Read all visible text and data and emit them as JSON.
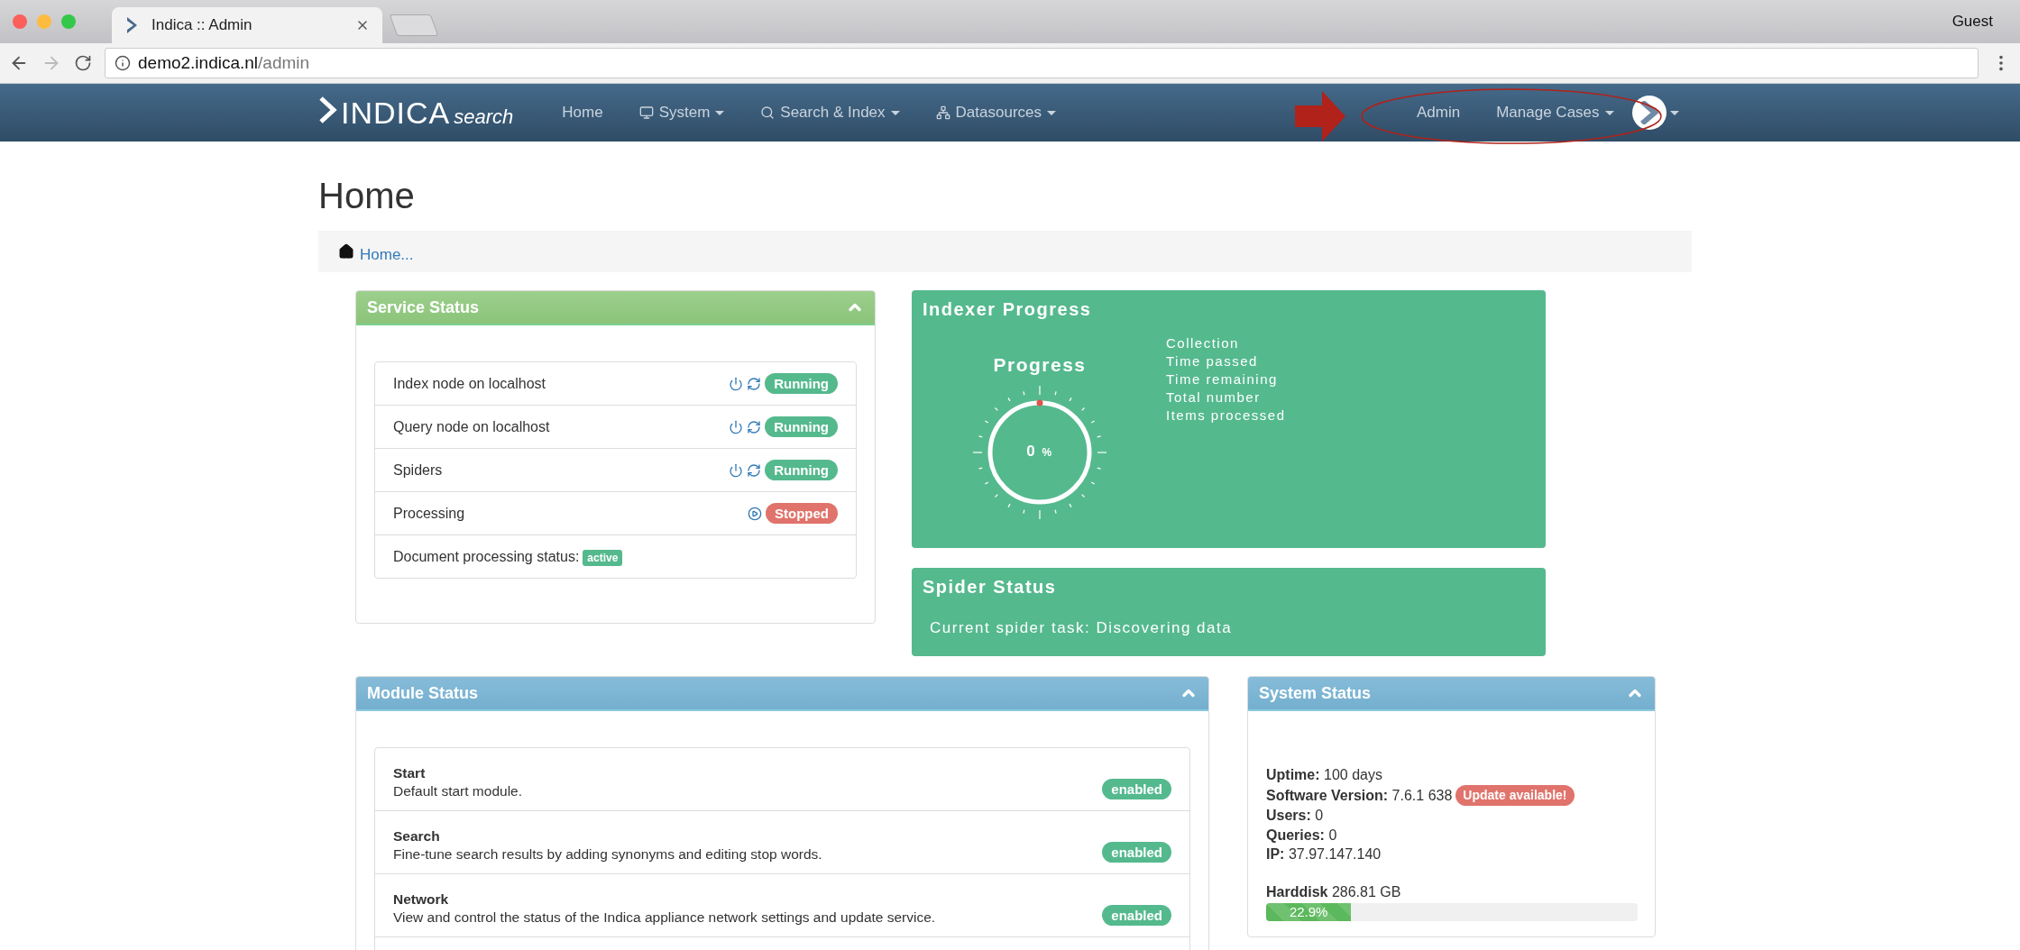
{
  "browser": {
    "tab_title": "Indica :: Admin",
    "address_host": "demo2.indica.nl",
    "address_path": "/admin",
    "profile": "Guest"
  },
  "navbar": {
    "brand": "INDICA",
    "brand_suffix": "search",
    "items": [
      {
        "label": "Home",
        "kind": "link"
      },
      {
        "label": "System",
        "kind": "menu"
      },
      {
        "label": "Search & Index",
        "kind": "menu"
      },
      {
        "label": "Datasources",
        "kind": "menu"
      }
    ],
    "right_items": [
      {
        "label": "Admin",
        "kind": "link"
      },
      {
        "label": "Manage Cases",
        "kind": "menu"
      }
    ]
  },
  "page": {
    "title": "Home",
    "breadcrumb": "Home..."
  },
  "service_status": {
    "title": "Service Status",
    "rows": [
      {
        "name": "Index node on localhost",
        "kind": "service",
        "running": true,
        "status": "Running"
      },
      {
        "name": "Query node on localhost",
        "kind": "service",
        "running": true,
        "status": "Running"
      },
      {
        "name": "Spiders",
        "kind": "service",
        "running": true,
        "status": "Running"
      },
      {
        "name": "Processing",
        "kind": "service",
        "running": false,
        "status": "Stopped"
      },
      {
        "name": "Document processing status:",
        "kind": "note",
        "status": "active"
      }
    ]
  },
  "indexer_progress": {
    "title": "Indexer Progress",
    "gauge_title": "Progress",
    "reading": "0",
    "unit": "%",
    "labels": [
      "Collection",
      "Time passed",
      "Time remaining",
      "Total number",
      "Items processed"
    ]
  },
  "spider_status": {
    "title": "Spider Status",
    "text": "Current spider task: Discovering data"
  },
  "module_status": {
    "title": "Module Status",
    "modules": [
      {
        "name": "Start",
        "description": "Default start module.",
        "status": "enabled"
      },
      {
        "name": "Search",
        "description": "Fine-tune search results by adding synonyms and editing stop words.",
        "status": "enabled"
      },
      {
        "name": "Network",
        "description": "View and control the status of the Indica appliance network settings and update service.",
        "status": "enabled"
      }
    ]
  },
  "system_status": {
    "title": "System Status",
    "fields": [
      {
        "label": "Uptime:",
        "value": "100 days"
      },
      {
        "label": "Software Version:",
        "value": "7.6.1 638",
        "badge": "Update available!"
      },
      {
        "label": "Users:",
        "value": "0"
      },
      {
        "label": "Queries:",
        "value": "0"
      },
      {
        "label": "IP:",
        "value": "37.97.147.140"
      }
    ],
    "harddisk": {
      "label": "Harddisk",
      "value": "286.81 GB",
      "level": 0.229,
      "reading": "22.9%"
    }
  }
}
